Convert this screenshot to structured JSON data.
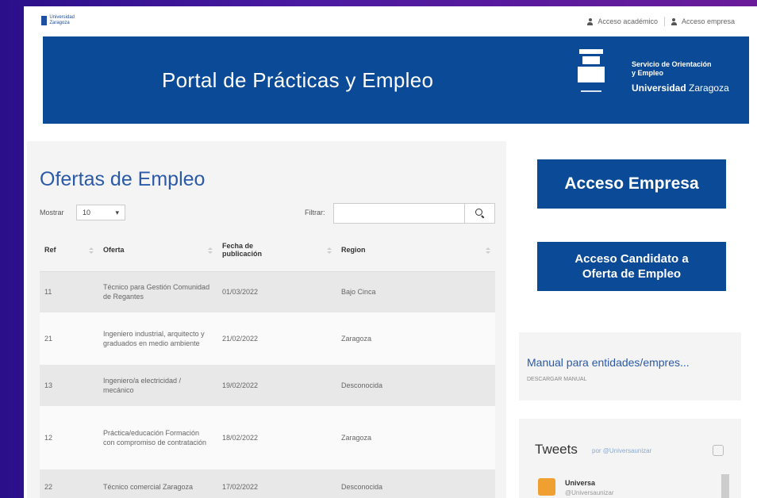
{
  "topbar": {
    "logo_text": "Universidad Zaragoza",
    "academic_access": "Acceso académico",
    "company_access": "Acceso empresa"
  },
  "banner": {
    "title": "Portal de Prácticas y Empleo",
    "service_line1": "Servicio de Orientación",
    "service_line2": "y Empleo",
    "uni_bold": "Universidad",
    "uni_regular": "Zaragoza"
  },
  "offers": {
    "title": "Ofertas de Empleo",
    "show_label": "Mostrar",
    "show_value": "10",
    "filter_label": "Filtrar:",
    "filter_value": "",
    "columns": [
      "Ref",
      "Oferta",
      "Fecha de publicación",
      "Region"
    ],
    "rows": [
      {
        "ref": "11",
        "oferta": "Técnico para Gestión Comunidad de Regantes",
        "fecha": "01/03/2022",
        "region": "Bajo Cinca"
      },
      {
        "ref": "21",
        "oferta": "Ingeniero industrial, arquitecto y graduados en medio ambiente",
        "fecha": "21/02/2022",
        "region": "Zaragoza"
      },
      {
        "ref": "13",
        "oferta": "Ingeniero/a electricidad / mecánico",
        "fecha": "19/02/2022",
        "region": "Desconocida"
      },
      {
        "ref": "12",
        "oferta": "Práctica/educación Formación con compromiso de contratación",
        "fecha": "18/02/2022",
        "region": "Zaragoza"
      },
      {
        "ref": "22",
        "oferta": "Técnico comercial Zaragoza",
        "fecha": "17/02/2022",
        "region": "Desconocida"
      }
    ]
  },
  "sidebar": {
    "empresa_button": "Acceso Empresa",
    "candidato_line1": "Acceso Candidato a",
    "candidato_line2": "Oferta de Empleo",
    "manual_title": "Manual para entidades/empres...",
    "manual_sub": "DESCARGAR MANUAL",
    "tweets_title": "Tweets",
    "tweets_by": "por @Universaunizar",
    "tweet_name": "Universa",
    "tweet_handle": "@Universaunizar"
  }
}
